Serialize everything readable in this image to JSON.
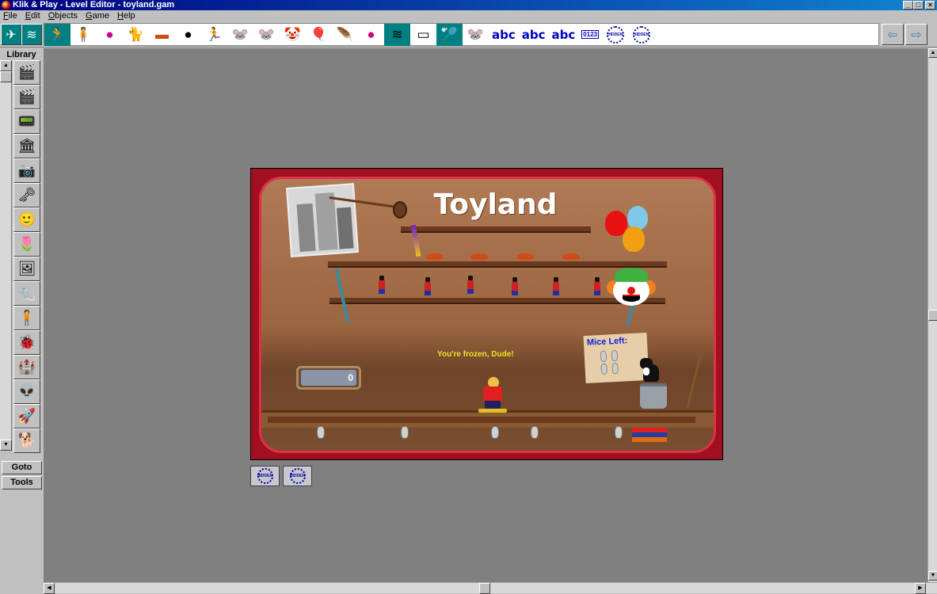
{
  "window": {
    "title": "Klik & Play - Level Editor - toyland.gam",
    "controls": [
      "_",
      "□",
      "×"
    ]
  },
  "menu": [
    "File",
    "Edit",
    "Objects",
    "Game",
    "Help"
  ],
  "toolbar": {
    "mode_buttons": [
      "level-editor-mode-icon",
      "event-editor-mode-icon"
    ],
    "objects": [
      {
        "icon": "🏃",
        "name": "runner-object-icon",
        "selected": true
      },
      {
        "icon": "🧍",
        "name": "kid-object-icon"
      },
      {
        "icon": "●",
        "name": "pink-ball-object-icon",
        "color": "#d00080"
      },
      {
        "icon": "🐈",
        "name": "cat-object-icon"
      },
      {
        "icon": "▬",
        "name": "toy-car-object-icon",
        "color": "#d04a1a"
      },
      {
        "icon": "●",
        "name": "black-dot-object-icon",
        "color": "#000000"
      },
      {
        "icon": "🏃",
        "name": "soldier-object-icon"
      },
      {
        "icon": "🐭",
        "name": "mouse-object-icon"
      },
      {
        "icon": "🐭",
        "name": "mouse-2-object-icon"
      },
      {
        "icon": "🤡",
        "name": "clown-object-icon"
      },
      {
        "icon": "🎈",
        "name": "balloons-object-icon"
      },
      {
        "icon": "🪶",
        "name": "feather-object-icon"
      },
      {
        "icon": "●",
        "name": "pink-ball-2-object-icon",
        "color": "#d00080"
      },
      {
        "icon": "≋",
        "name": "wave-object-icon",
        "selected": true
      },
      {
        "icon": "▭",
        "name": "board-object-icon"
      },
      {
        "icon": "🏸",
        "name": "racket-object-icon",
        "selected": true
      },
      {
        "icon": "🐭",
        "name": "mouse-3-object-icon"
      }
    ],
    "text_objects": [
      "abc",
      "abc",
      "abc"
    ],
    "counter_label": "0123",
    "hidden_label": "HIDDEN",
    "nav_arrows": [
      "⇦",
      "⇨"
    ]
  },
  "library": {
    "title": "Library",
    "items": [
      {
        "icon": "🎬",
        "name": "library-clapper-icon"
      },
      {
        "icon": "🎬",
        "name": "library-clapper-2-icon"
      },
      {
        "icon": "📟",
        "name": "library-counter-icon"
      },
      {
        "icon": "🏛",
        "name": "library-building-icon"
      },
      {
        "icon": "📷",
        "name": "library-camera-icon"
      },
      {
        "icon": "🗝",
        "name": "library-key-icon"
      },
      {
        "icon": "🙂",
        "name": "library-face-icon"
      },
      {
        "icon": "🌷",
        "name": "library-flower-icon"
      },
      {
        "icon": "🖼",
        "name": "library-portrait-icon"
      },
      {
        "icon": "🐀",
        "name": "library-rat-icon"
      },
      {
        "icon": "🧍",
        "name": "library-person-icon"
      },
      {
        "icon": "🐞",
        "name": "library-bug-icon"
      },
      {
        "icon": "🏰",
        "name": "library-castle-icon"
      },
      {
        "icon": "👽",
        "name": "library-alien-icon"
      },
      {
        "icon": "🚀",
        "name": "library-rocket-icon"
      },
      {
        "icon": "🐕",
        "name": "library-dog-icon"
      }
    ],
    "goto_label": "Goto",
    "tools_label": "Tools"
  },
  "scene": {
    "title": "Toyland",
    "message": "You're frozen, Dude!",
    "score_value": "0",
    "mice_label": "Mice Left:",
    "hidden_objects": [
      "HIDDEN",
      "HIDDEN"
    ]
  }
}
